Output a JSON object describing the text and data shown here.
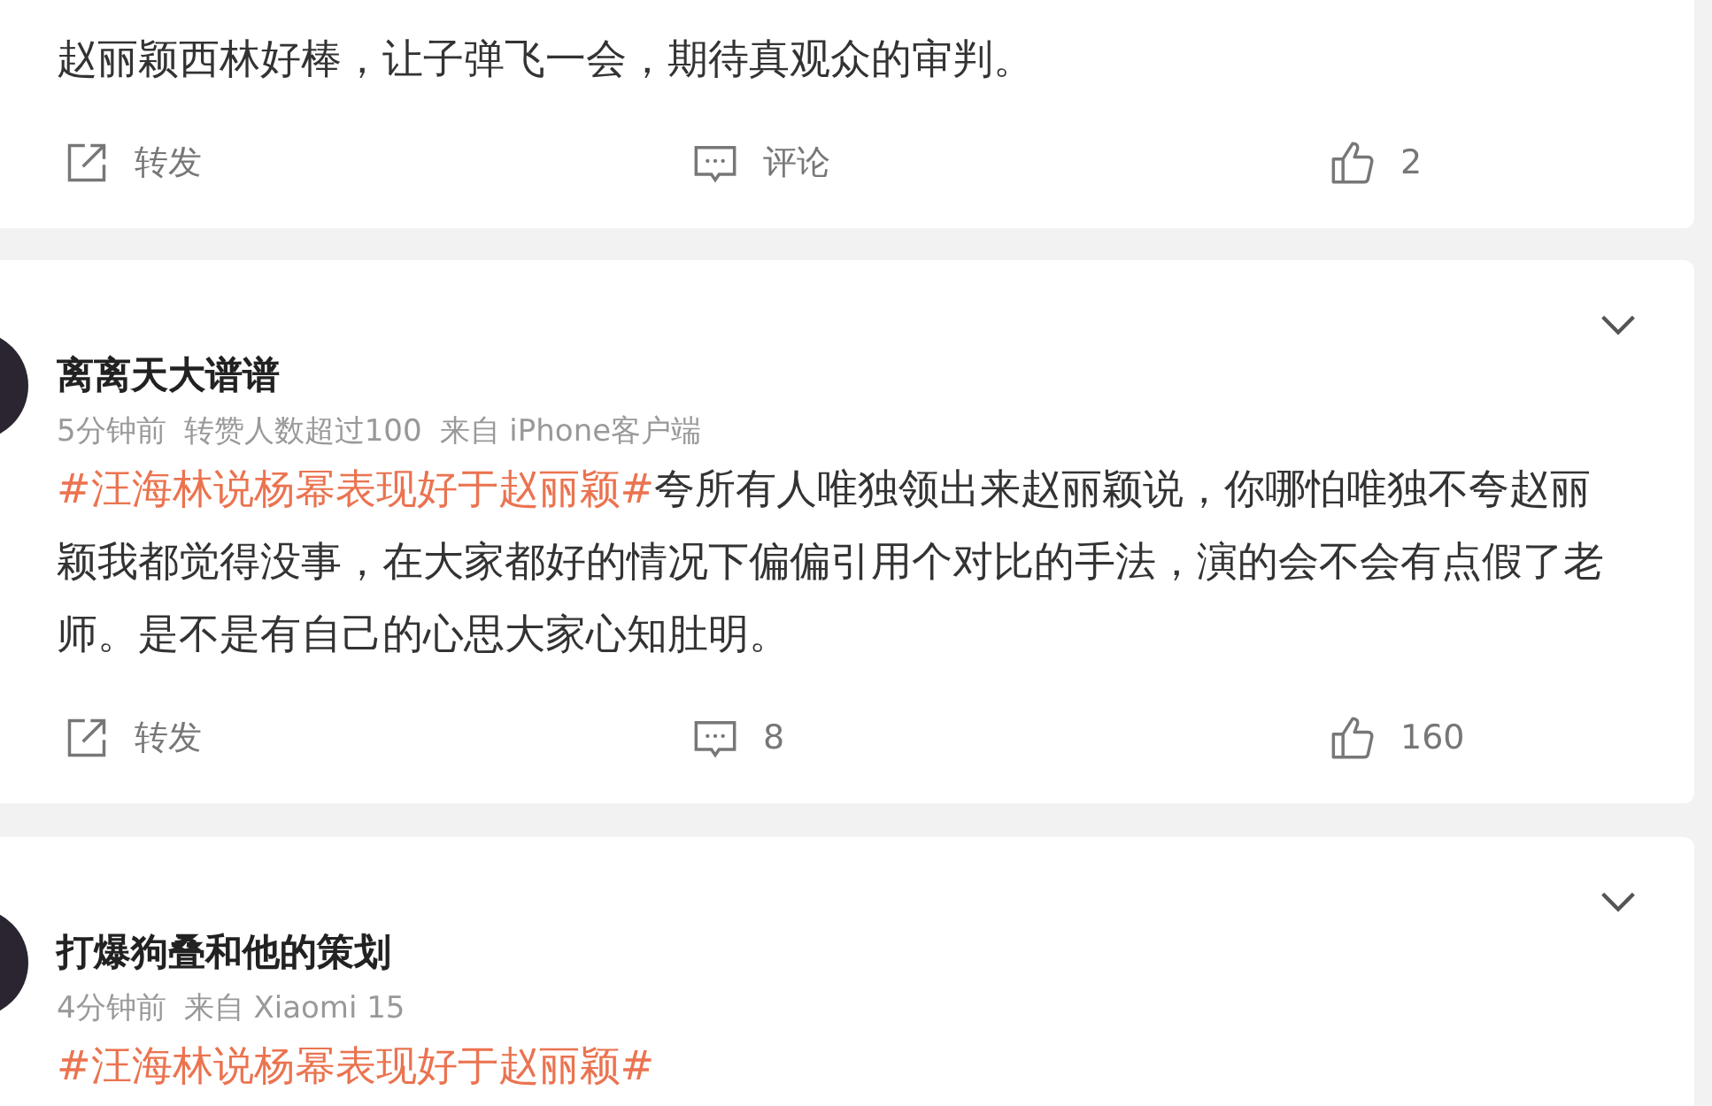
{
  "posts": [
    {
      "text": "赵丽颖西林好棒，让子弹飞一会，期待真观众的审判。",
      "actions": {
        "repost": "转发",
        "comment": "评论",
        "like": "2"
      }
    },
    {
      "author": "离离天大谱谱",
      "meta": [
        "5分钟前",
        "转赞人数超过100",
        "来自 iPhone客户端"
      ],
      "topic": "#汪海林说杨幂表现好于赵丽颖#",
      "text": "夸所有人唯独领出来赵丽颖说，你哪怕唯独不夸赵丽颖我都觉得没事，在大家都好的情况下偏偏引用个对比的手法，演的会不会有点假了老师。是不是有自己的心思大家心知肚明。",
      "actions": {
        "repost": "转发",
        "comment": "8",
        "like": "160"
      }
    },
    {
      "author": "打爆狗叠和他的策划",
      "meta": [
        "4分钟前",
        "来自 Xiaomi 15"
      ],
      "topic": "#汪海林说杨幂表现好于赵丽颖#"
    }
  ]
}
